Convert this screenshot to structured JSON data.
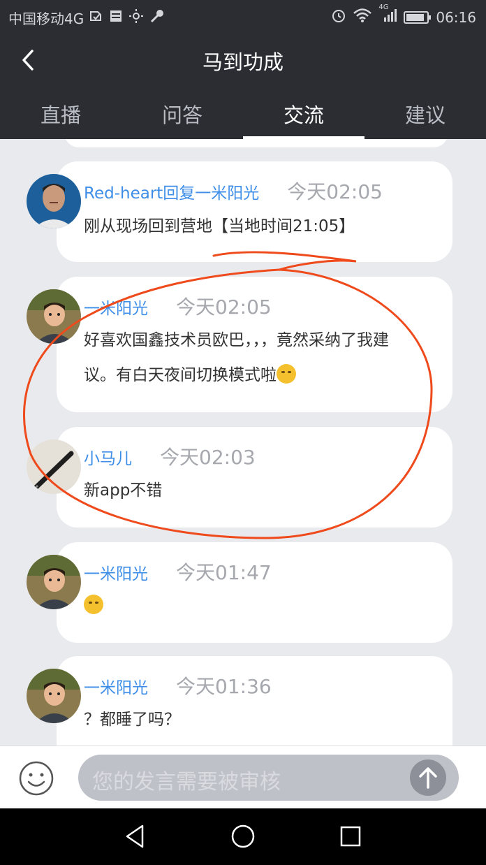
{
  "status_bar": {
    "carrier": "中国移动4G",
    "network_badge": "4G",
    "time": "06:16",
    "battery_level": 0.9,
    "icons": [
      "sim-icon",
      "storage-icon",
      "brightness-icon",
      "key-icon",
      "alarm-icon",
      "wifi-icon",
      "signal-icon",
      "battery-icon"
    ]
  },
  "header": {
    "title": "马到功成",
    "back_icon": "chevron-left-icon"
  },
  "tabs": [
    {
      "label": "直播",
      "active": false
    },
    {
      "label": "问答",
      "active": false
    },
    {
      "label": "交流",
      "active": true
    },
    {
      "label": "建议",
      "active": false
    }
  ],
  "messages": [
    {
      "author": "Red-heart",
      "reply_word": "回复",
      "reply_to": "一米阳光",
      "time": "今天02:05",
      "lines": [
        "刚从现场回到营地【当地时间21:05】"
      ]
    },
    {
      "author": "一米阳光",
      "time": "今天02:05",
      "lines": [
        "好喜欢国鑫技术员欧巴，，，竟然采纳了我建",
        "议。有白天夜间切换模式啦"
      ],
      "emoji": "kissing-face-emoji"
    },
    {
      "author": "小马儿",
      "time": "今天02:03",
      "lines": [
        "新app不错"
      ]
    },
    {
      "author": "一米阳光",
      "time": "今天01:47",
      "lines": [],
      "emoji": "grinning-face-emoji"
    },
    {
      "author": "一米阳光",
      "time": "今天01:36",
      "lines": [
        "？都睡了吗？"
      ]
    }
  ],
  "input_bar": {
    "placeholder": "您的发言需要被审核",
    "emoji_icon": "smiley-icon",
    "send_icon": "arrow-up-icon"
  },
  "nav_bar": {
    "icons": [
      "back-triangle-icon",
      "home-circle-icon",
      "recents-square-icon"
    ]
  },
  "colors": {
    "header_bg": "#2b2d33",
    "accent_blue": "#3e8ee8",
    "annotation_red": "#ee4a1c",
    "feed_bg": "#e9eaee"
  }
}
